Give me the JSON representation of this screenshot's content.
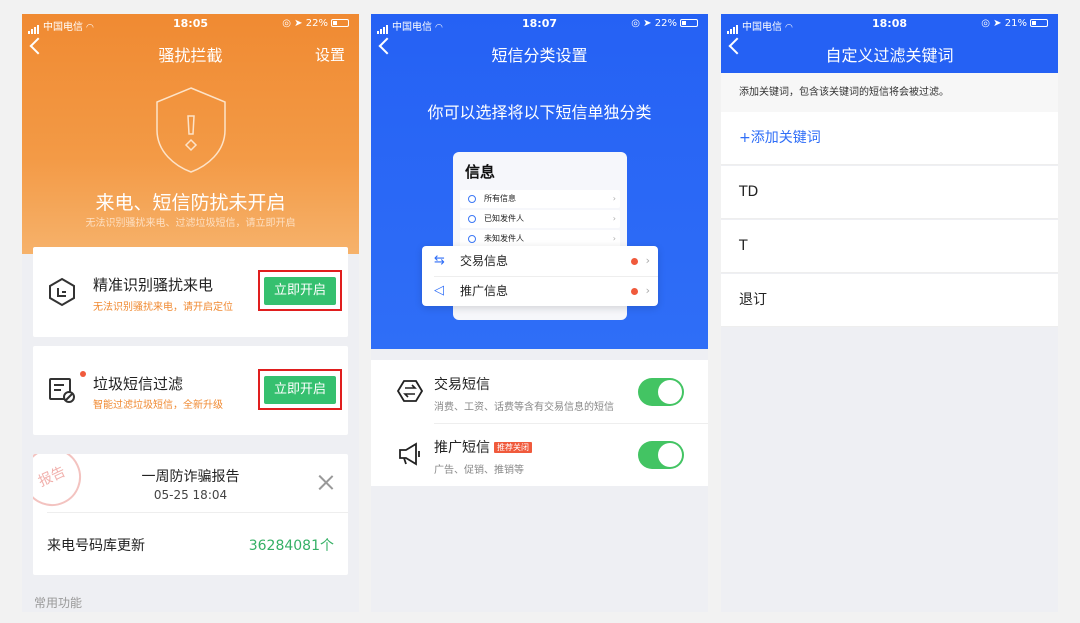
{
  "status": [
    {
      "carrier": "中国电信",
      "time": "18:05",
      "battery": "22%"
    },
    {
      "carrier": "中国电信",
      "time": "18:07",
      "battery": "22%"
    },
    {
      "carrier": "中国电信",
      "time": "18:08",
      "battery": "21%"
    }
  ],
  "screen1": {
    "title": "骚扰拦截",
    "settings": "设置",
    "headline": "来电、短信防扰未开启",
    "subline": "无法识别骚扰来电、过滤垃圾短信，请立即开启",
    "cards": [
      {
        "title": "精准识别骚扰来电",
        "sub": "无法识别骚扰来电，请开启定位",
        "button": "立即开启"
      },
      {
        "title": "垃圾短信过滤",
        "sub": "智能过滤垃圾短信，全新升级",
        "button": "立即开启"
      }
    ],
    "report": {
      "stamp": "报告",
      "title": "一周防诈骗报告",
      "date": "05-25 18:04",
      "update_label": "来电号码库更新",
      "update_value": "36284081个"
    },
    "common": "常用功能"
  },
  "screen2": {
    "title": "短信分类设置",
    "headline": "你可以选择将以下短信单独分类",
    "mock": {
      "title": "信息",
      "rows": [
        "所有信息",
        "已知发件人",
        "未知发件人"
      ],
      "float_rows": [
        "交易信息",
        "推广信息"
      ]
    },
    "items": [
      {
        "title": "交易短信",
        "sub": "消费、工资、话费等含有交易信息的短信",
        "badge": "",
        "enabled": true
      },
      {
        "title": "推广短信",
        "sub": "广告、促销、推销等",
        "badge": "推荐关闭",
        "enabled": true
      }
    ]
  },
  "screen3": {
    "title": "自定义过滤关键词",
    "hint": "添加关键词，包含该关键词的短信将会被过滤。",
    "add": "+添加关键词",
    "keywords": [
      "TD",
      "T",
      "退订"
    ]
  }
}
